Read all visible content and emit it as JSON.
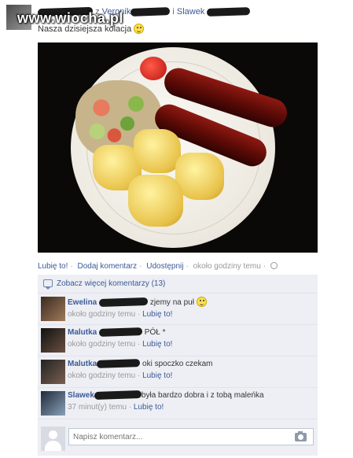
{
  "watermark": "www.wiocha.pl",
  "post": {
    "header_names": [
      "Veronik",
      "Slawek"
    ],
    "header_separator": "z",
    "header_and": "i",
    "text": "Nasza dzisiejsza kolacja"
  },
  "actions": {
    "like": "Lubię to!",
    "comment": "Dodaj komentarz",
    "share": "Udostępnij",
    "time": "około godziny temu"
  },
  "comments_section": {
    "more": "Zobacz więcej komentarzy (13)",
    "comments": [
      {
        "name": "Ewelina",
        "text": "zjemy na puł",
        "time": "około godziny temu",
        "like": "Lubię to!"
      },
      {
        "name": "Malutka",
        "text": "PÓŁ *",
        "time": "około godziny temu",
        "like": "Lubię to!"
      },
      {
        "name": "Malutka",
        "text": "oki spoczko czekam",
        "time": "około godziny temu",
        "like": "Lubię to!"
      },
      {
        "name": "Slawek",
        "text": "była bardzo dobra i z tobą maleńka",
        "time": "37 minut(y) temu",
        "like": "Lubię to!"
      }
    ],
    "write_placeholder": "Napisz komentarz..."
  }
}
